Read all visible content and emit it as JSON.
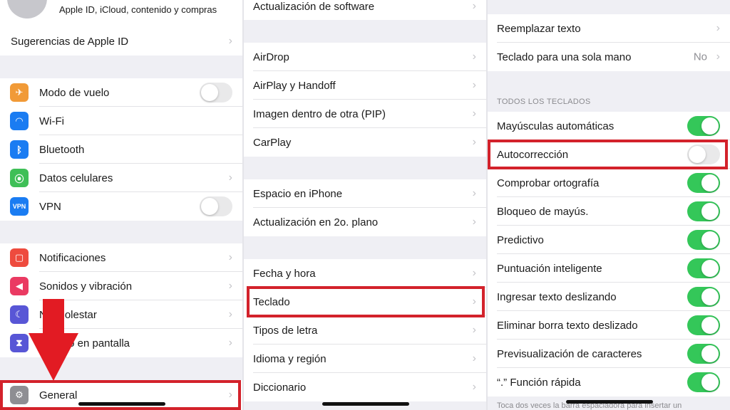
{
  "panel1": {
    "apple_id_subtitle": "Apple ID, iCloud, contenido y compras",
    "apple_id_suggestions": "Sugerencias de Apple ID",
    "group1": [
      {
        "label": "Modo de vuelo",
        "icon": "airplane-icon",
        "color": "#f19a37",
        "control": "toggle",
        "on": false
      },
      {
        "label": "Wi-Fi",
        "icon": "wifi-icon",
        "color": "#1a7cf2",
        "control": "none"
      },
      {
        "label": "Bluetooth",
        "icon": "bluetooth-icon",
        "color": "#1a7cf2",
        "control": "none"
      },
      {
        "label": "Datos celulares",
        "icon": "antenna-icon",
        "color": "#3fbf57",
        "control": "chevron"
      },
      {
        "label": "VPN",
        "icon": "vpn-icon",
        "color": "#1a7cf2",
        "control": "toggle",
        "on": false,
        "icon_text": "VPN"
      }
    ],
    "group2": [
      {
        "label": "Notificaciones",
        "icon": "notifications-icon",
        "color": "#ee4b3e"
      },
      {
        "label": "Sonidos y vibración",
        "icon": "speaker-icon",
        "color": "#ea3a62"
      },
      {
        "label": "No molestar",
        "icon": "moon-icon",
        "color": "#5856d6"
      },
      {
        "label": "Tiempo en pantalla",
        "icon": "hourglass-icon",
        "color": "#5856d6"
      }
    ],
    "general": {
      "label": "General",
      "icon": "gear-icon",
      "color": "#8e8e93"
    },
    "arrow_color": "#e21b23"
  },
  "panel2": {
    "top": "Actualización de software",
    "group1": [
      "AirDrop",
      "AirPlay y Handoff",
      "Imagen dentro de otra (PIP)",
      "CarPlay"
    ],
    "group2": [
      "Espacio en iPhone",
      "Actualización en 2o. plano"
    ],
    "group3": [
      "Fecha y hora",
      "Teclado",
      "Tipos de letra",
      "Idioma y región",
      "Diccionario"
    ]
  },
  "panel3": {
    "top": [
      {
        "label": "Reemplazar texto",
        "value": ""
      },
      {
        "label": "Teclado para una sola mano",
        "value": "No"
      }
    ],
    "section_header": "TODOS LOS TECLADOS",
    "toggles": [
      {
        "label": "Mayúsculas automáticas",
        "on": true
      },
      {
        "label": "Autocorrección",
        "on": false
      },
      {
        "label": "Comprobar ortografía",
        "on": true
      },
      {
        "label": "Bloqueo de mayús.",
        "on": true
      },
      {
        "label": "Predictivo",
        "on": true
      },
      {
        "label": "Puntuación inteligente",
        "on": true
      },
      {
        "label": "Ingresar texto deslizando",
        "on": true
      },
      {
        "label": "Eliminar borra texto deslizado",
        "on": true
      },
      {
        "label": "Previsualización de caracteres",
        "on": true
      },
      {
        "label": "“.” Función rápida",
        "on": true
      }
    ],
    "footer": "Toca dos veces la barra espaciadora para insertar un"
  },
  "chevron_glyph": "›",
  "highlight_color": "#d3222b",
  "toggle_on_color": "#34c759"
}
